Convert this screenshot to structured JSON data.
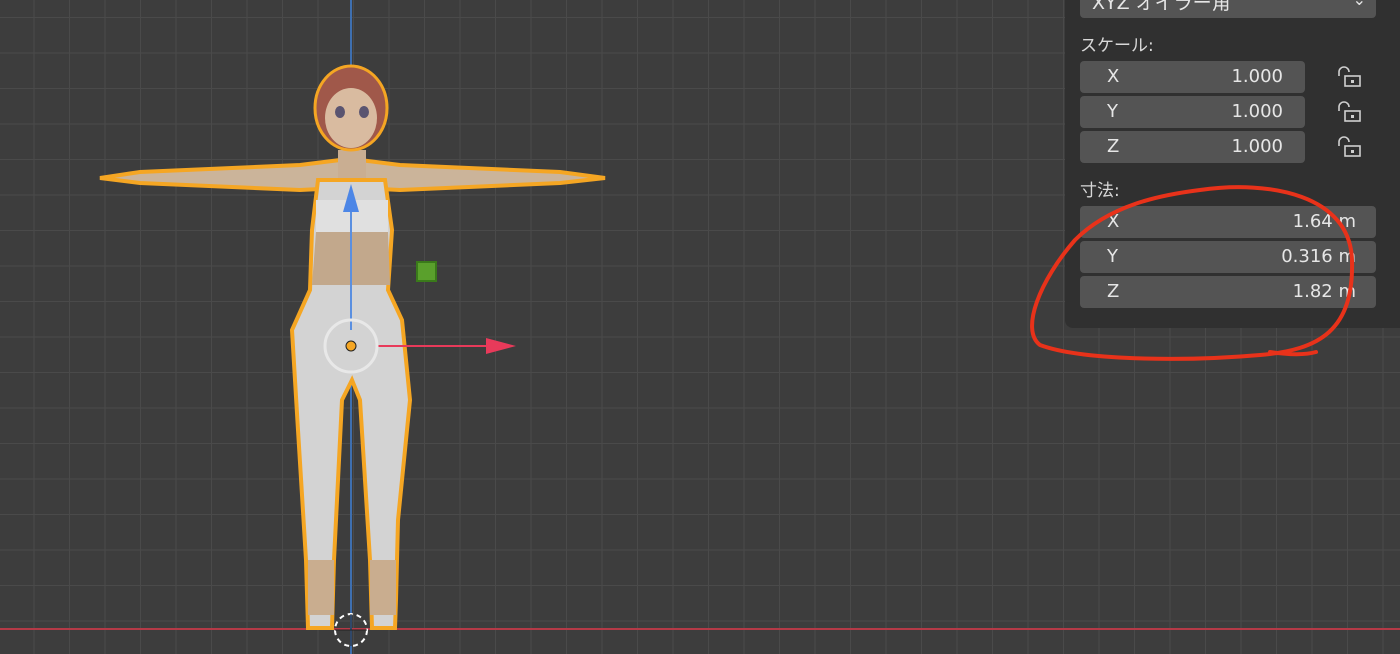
{
  "viewport": {
    "selection_color": "#f5a623",
    "grid_color": "#4a4a4a",
    "x_axis_color": "#e83a5a",
    "z_axis_color": "#3e8de8"
  },
  "panel": {
    "rotation_mode": "XYZ オイラー角",
    "scale_label": "スケール:",
    "scale": [
      {
        "axis": "X",
        "value": "1.000"
      },
      {
        "axis": "Y",
        "value": "1.000"
      },
      {
        "axis": "Z",
        "value": "1.000"
      }
    ],
    "dimensions_label": "寸法:",
    "dimensions": [
      {
        "axis": "X",
        "value": "1.64 m"
      },
      {
        "axis": "Y",
        "value": "0.316 m"
      },
      {
        "axis": "Z",
        "value": "1.82 m"
      }
    ]
  },
  "annotation": {
    "color": "#e8321a"
  },
  "icons": [
    "unlock-icon",
    "chevron-down-icon",
    "object-origin-icon",
    "move-arrow-x-icon",
    "move-arrow-z-icon",
    "light-icon",
    "3d-cursor-icon"
  ]
}
